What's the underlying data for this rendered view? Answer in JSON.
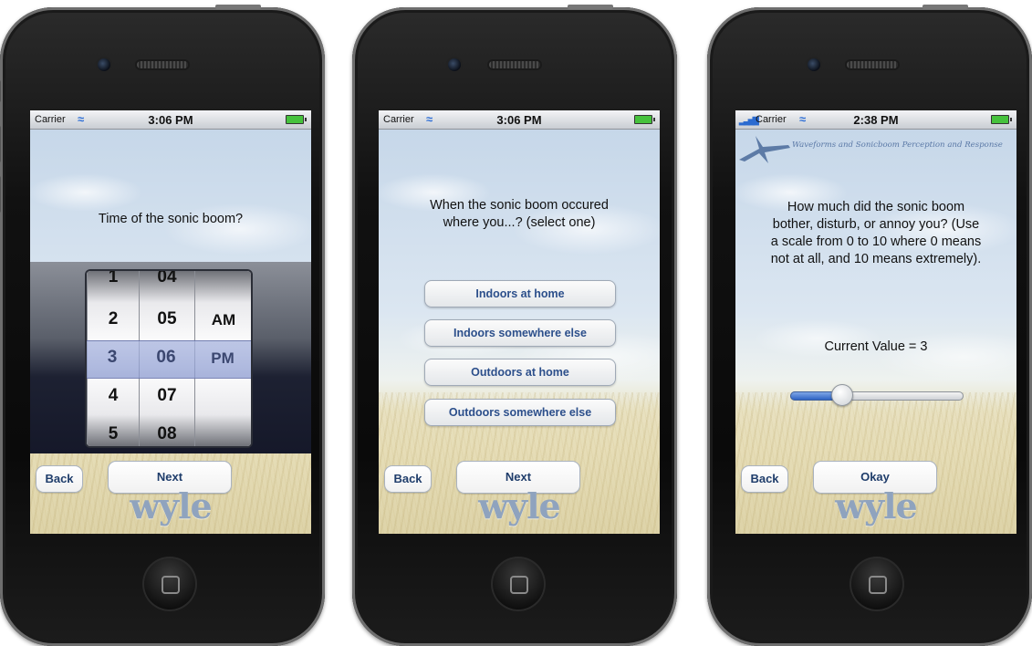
{
  "phones": [
    {
      "status": {
        "carrier": "Carrier",
        "time": "3:06 PM"
      },
      "question": "Time of the sonic boom?",
      "picker": {
        "hours": [
          "1",
          "2",
          "3",
          "4",
          "5"
        ],
        "minutes": [
          "04",
          "05",
          "06",
          "07",
          "08"
        ],
        "ampm": [
          "AM",
          "PM"
        ],
        "selected": {
          "hour": "3",
          "minute": "06",
          "ampm": "PM"
        }
      },
      "back_label": "Back",
      "next_label": "Next",
      "logo": "wyle"
    },
    {
      "status": {
        "carrier": "Carrier",
        "time": "3:06 PM"
      },
      "question_line1": "When the sonic boom occured",
      "question_line2": "where you...?  (select one)",
      "options": [
        "Indoors at home",
        "Indoors somewhere else",
        "Outdoors at home",
        "Outdoors somewhere else"
      ],
      "back_label": "Back",
      "next_label": "Next",
      "logo": "wyle"
    },
    {
      "status": {
        "carrier": "Carrier",
        "time": "2:38 PM"
      },
      "banner": "Waveforms and Sonicboom Perception and Response",
      "question_lines": [
        "How much did the sonic boom",
        "bother, disturb, or annoy you? (Use",
        "a scale from 0 to 10 where 0 means",
        "not at all, and 10 means extremely)."
      ],
      "current_value_text": "Current Value = 3",
      "slider": {
        "min": 0,
        "max": 10,
        "value": 3
      },
      "back_label": "Back",
      "okay_label": "Okay",
      "logo": "wyle"
    }
  ],
  "colors": {
    "button_text": "#1f3d6b",
    "slider_fill": "#2e63c4",
    "logo": "#8fa3be"
  }
}
